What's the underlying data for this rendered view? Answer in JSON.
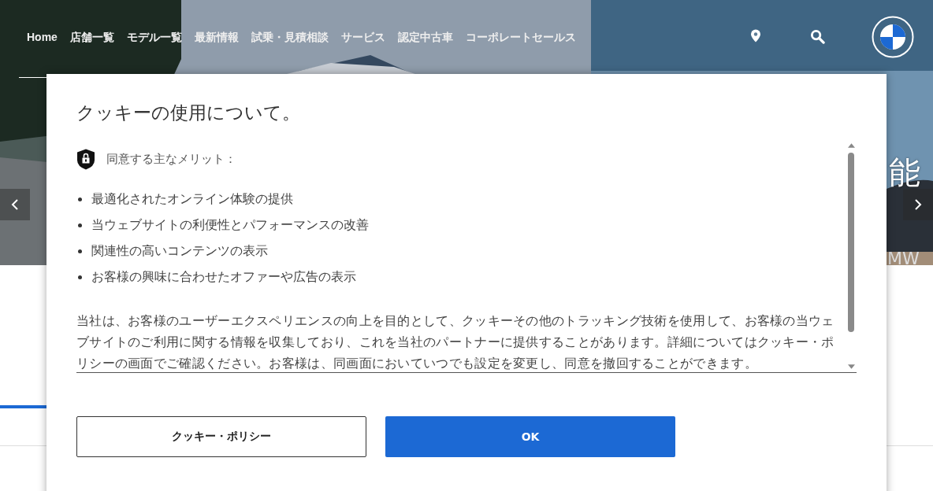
{
  "nav": {
    "items": [
      {
        "label": "Home"
      },
      {
        "label": "店舗一覧"
      },
      {
        "label": "モデル一覧"
      },
      {
        "label": "最新情報"
      },
      {
        "label": "試乗・見積相談"
      },
      {
        "label": "サービス"
      },
      {
        "label": "認定中古車"
      },
      {
        "label": "コーポレートセールス"
      }
    ]
  },
  "hero": {
    "headline": "能",
    "caption": "MW"
  },
  "cookie_dialog": {
    "title": "クッキーの使用について。",
    "benefits_heading": "同意する主なメリット：",
    "benefits": [
      "最適化されたオンライン体験の提供",
      "当ウェブサイトの利便性とパフォーマンスの改善",
      "関連性の高いコンテンツの表示",
      "お客様の興味に合わせたオファーや広告の表示"
    ],
    "body": "当社は、お客様のユーザーエクスペリエンスの向上を目的として、クッキーその他のトラッキング技術を使用して、お客様の当ウェブサイトのご利用に関する情報を収集しており、これを当社のパートナーに提供することがあります。詳細についてはクッキー・ポリシーの画面でご確認ください。お客様は、同画面においていつでも設定を変更し、同意を撤回することができます。",
    "buttons": [
      {
        "label": "クッキー・ポリシー",
        "kind": "secondary"
      },
      {
        "label": "OK",
        "kind": "primary"
      }
    ]
  }
}
